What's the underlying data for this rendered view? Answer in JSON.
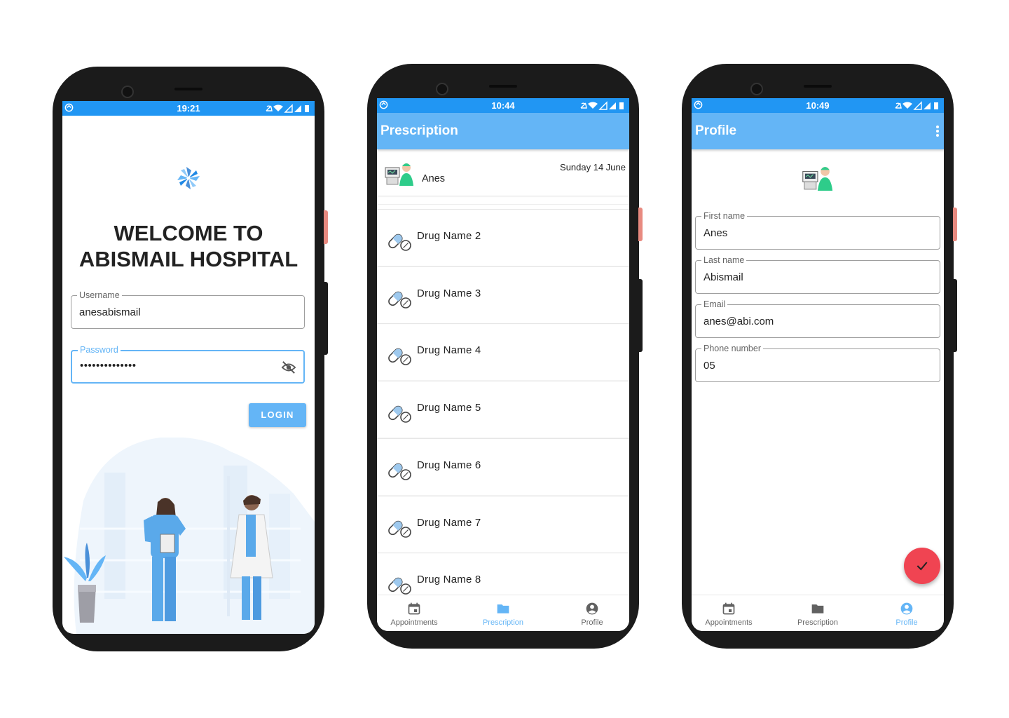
{
  "colors": {
    "status_bar": "#2196f3",
    "app_bar": "#64b5f6",
    "accent": "#64b5f6",
    "fab": "#f04452"
  },
  "login": {
    "status_time": "19:21",
    "logo_icon": "pinwheel-logo-icon",
    "welcome_line1": "WELCOME TO",
    "welcome_line2": "ABISMAIL HOSPITAL",
    "username_label": "Username",
    "username_value": "anesabismail",
    "password_label": "Password",
    "password_value": "••••••••••••••",
    "login_label": "LOGIN",
    "visibility_icon": "eye-off-icon"
  },
  "prescription": {
    "status_time": "10:44",
    "title": "Prescription",
    "date": "Sunday 14 June",
    "patient_name": "Anes",
    "drugs": [
      "Drug Name 2",
      "Drug Name 3",
      "Drug Name 4",
      "Drug Name 5",
      "Drug Name 6",
      "Drug Name 7",
      "Drug Name 8"
    ],
    "nav": [
      {
        "label": "Appointments",
        "icon": "calendar-icon"
      },
      {
        "label": "Prescription",
        "icon": "folder-icon"
      },
      {
        "label": "Profile",
        "icon": "account-circle-icon"
      }
    ]
  },
  "profile": {
    "status_time": "10:49",
    "title": "Profile",
    "menu_icon": "more-vert-icon",
    "first_name_label": "First name",
    "first_name_value": "Anes",
    "last_name_label": "Last name",
    "last_name_value": "Abismail",
    "email_label": "Email",
    "email_value": "anes@abi.com",
    "phone_label": "Phone number",
    "phone_value": "05",
    "fab_icon": "check-icon",
    "nav": [
      {
        "label": "Appointments",
        "icon": "calendar-icon"
      },
      {
        "label": "Prescription",
        "icon": "folder-icon"
      },
      {
        "label": "Profile",
        "icon": "account-circle-icon"
      }
    ]
  }
}
